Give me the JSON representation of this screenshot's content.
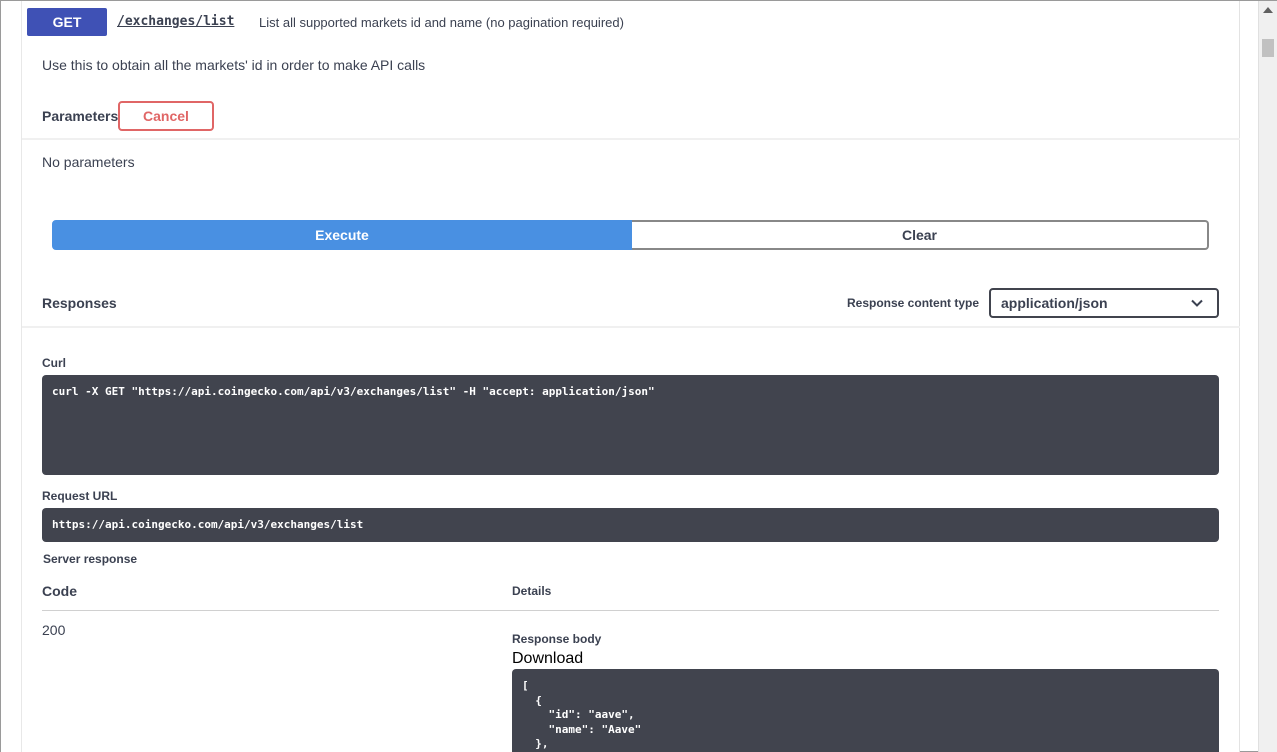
{
  "operation": {
    "method": "GET",
    "path": "/exchanges/list",
    "summary": "List all supported markets id and name (no pagination required)",
    "description": "Use this to obtain all the markets' id in order to make API calls"
  },
  "parameters": {
    "title": "Parameters",
    "cancel_label": "Cancel",
    "empty_text": "No parameters"
  },
  "actions": {
    "execute_label": "Execute",
    "clear_label": "Clear"
  },
  "responses": {
    "title": "Responses",
    "content_type_label": "Response content type",
    "content_type_value": "application/json"
  },
  "curl": {
    "label": "Curl",
    "command": "curl -X GET \"https://api.coingecko.com/api/v3/exchanges/list\" -H \"accept: application/json\""
  },
  "request_url": {
    "label": "Request URL",
    "value": "https://api.coingecko.com/api/v3/exchanges/list"
  },
  "server_response": {
    "label": "Server response",
    "code_header": "Code",
    "details_header": "Details",
    "status_code": "200",
    "body_label": "Response body",
    "download_label": "Download",
    "body_text": "[\n  {\n    \"id\": \"aave\",\n    \"name\": \"Aave\"\n  },"
  },
  "colors": {
    "get_method": "#3f51b5",
    "execute": "#4990e2",
    "cancel": "#e06666",
    "code_bg": "#41444e"
  }
}
